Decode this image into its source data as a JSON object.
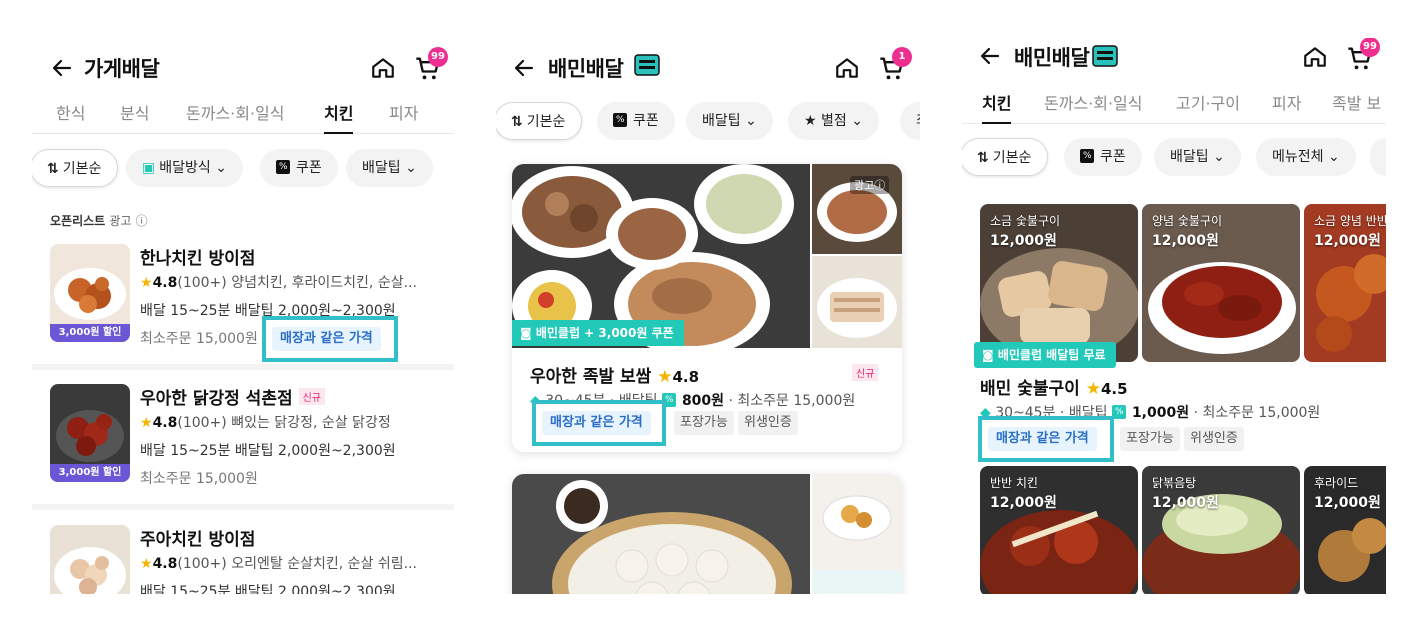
{
  "panel1": {
    "title": "가게배달",
    "cart_count": "99",
    "tabs": [
      "한식",
      "분식",
      "돈까스·회·일식",
      "치킨",
      "피자"
    ],
    "active_tab": "치킨",
    "chips": {
      "sort": "기본순",
      "delivery": "배달방식",
      "coupon": "쿠폰",
      "fee": "배달팁"
    },
    "section_label": "오픈리스트",
    "section_ad": "광고",
    "shops": [
      {
        "name": "한나치킨 방이점",
        "new": "",
        "rating": "4.8",
        "reviews": "(100+)",
        "menu": "양념치킨, 후라이드치킨, 순살...",
        "delivery": "배달 15~25분  배달팁 2,000원~2,300원",
        "min_order": "최소주문 15,000원",
        "discount": "3,000원 할인",
        "price_tag": "매장과 같은 가격"
      },
      {
        "name": "우아한 닭강정 석촌점",
        "new": "신규",
        "rating": "4.8",
        "reviews": "(100+)",
        "menu": "뼈있는 닭강정, 순살 닭강정",
        "delivery": "배달 15~25분  배달팁 2,000원~2,300원",
        "min_order": "최소주문 15,000원",
        "discount": "3,000원 할인",
        "price_tag": ""
      },
      {
        "name": "주아치킨 방이점",
        "new": "",
        "rating": "4.8",
        "reviews": "(100+)",
        "menu": "오리엔탈 순살치킨, 순살 쉬림...",
        "delivery": "배달 15~25분  배달팁 2,000원~2,300원",
        "min_order": "",
        "discount": "",
        "price_tag": ""
      }
    ]
  },
  "panel2": {
    "title": "배민배달",
    "cart_count": "1",
    "chips": {
      "sort": "기본순",
      "coupon": "쿠폰",
      "fee": "배달팁",
      "rating": "별점",
      "more": "최"
    },
    "card": {
      "ad": "광고ⓘ",
      "club": "배민클럽 + 3,000원 쿠폰",
      "name": "우아한 족발 보쌈",
      "rating": "4.8",
      "new": "신규",
      "time": "30~45분",
      "fee_label": "배달팁",
      "fee": "800원",
      "min_order": "· 최소주문 15,000원",
      "price_tag": "매장과 같은 가격",
      "tags": [
        "포장가능",
        "위생인증"
      ]
    }
  },
  "panel3": {
    "title": "배민배달",
    "cart_count": "99",
    "tabs": [
      "치킨",
      "돈까스·회·일식",
      "고기·구이",
      "피자",
      "족발 보"
    ],
    "active_tab": "치킨",
    "chips": {
      "sort": "기본순",
      "coupon": "쿠폰",
      "fee": "배달팁",
      "menu": "메뉴전체"
    },
    "menus_top": [
      {
        "name": "소금 숯불구이",
        "price": "12,000원"
      },
      {
        "name": "양념 숯불구이",
        "price": "12,000원"
      },
      {
        "name": "소금 양념 반반",
        "price": "12,000원"
      }
    ],
    "club": "배민클럽 배달팁 무료",
    "shop_name": "배민 숯불구이",
    "rating": "4.5",
    "time": "30~45분",
    "fee_label": "배달팁",
    "fee": "1,000원",
    "min_order": "· 최소주문 15,000원",
    "price_tag": "매장과 같은 가격",
    "tags": [
      "포장가능",
      "위생인증"
    ],
    "menus_bottom": [
      {
        "name": "반반 치킨",
        "price": "12,000원"
      },
      {
        "name": "닭볶음탕",
        "price": "12,000원"
      },
      {
        "name": "후라이드",
        "price": "12,000원"
      }
    ]
  },
  "colors": {
    "highlight": "#33bfc9",
    "club": "#22c8b8",
    "discount": "#6b57d6",
    "cart_badge": "#ef2f8f",
    "price_tag_text": "#2a6ec6"
  },
  "icons": [
    "back-arrow-icon",
    "home-icon",
    "cart-icon",
    "sort-icon",
    "coupon-icon",
    "chevron-down-icon",
    "star-icon",
    "delivery-icon"
  ]
}
